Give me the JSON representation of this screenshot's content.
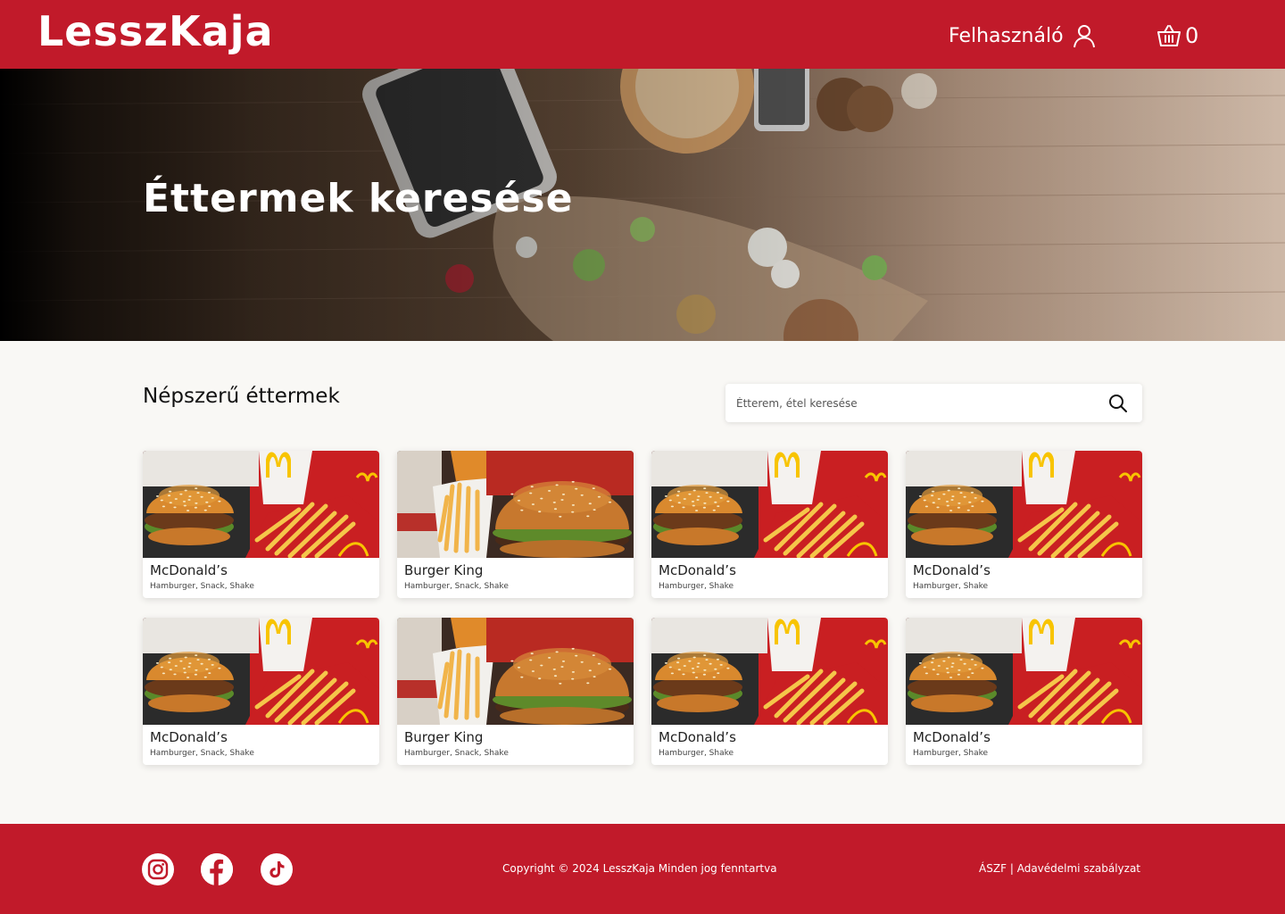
{
  "colors": {
    "brand": "#c11a2a",
    "page_bg": "#f9f8f5",
    "card_bg": "#ffffff"
  },
  "header": {
    "logo": "LesszKaja",
    "user_label": "Felhasználó",
    "user_icon": "user-icon",
    "cart_icon": "basket-icon",
    "cart_count": "0"
  },
  "hero": {
    "title": "Éttermek keresése"
  },
  "main": {
    "section_title": "Népszerű éttermek",
    "search": {
      "placeholder": "Étterem, étel keresése",
      "icon": "search-icon"
    },
    "restaurants": [
      {
        "name": "McDonald’s",
        "tags": "Hamburger, Snack, Shake",
        "image": "mcdonalds-meal"
      },
      {
        "name": "Burger King",
        "tags": "Hamburger, Snack, Shake",
        "image": "burger-king-meal"
      },
      {
        "name": "McDonald’s",
        "tags": "Hamburger, Shake",
        "image": "mcdonalds-meal"
      },
      {
        "name": "McDonald’s",
        "tags": "Hamburger, Shake",
        "image": "mcdonalds-meal"
      },
      {
        "name": "McDonald’s",
        "tags": "Hamburger, Snack, Shake",
        "image": "mcdonalds-meal"
      },
      {
        "name": "Burger King",
        "tags": "Hamburger, Snack, Shake",
        "image": "burger-king-meal"
      },
      {
        "name": "McDonald’s",
        "tags": "Hamburger, Shake",
        "image": "mcdonalds-meal"
      },
      {
        "name": "McDonald’s",
        "tags": "Hamburger, Shake",
        "image": "mcdonalds-meal"
      }
    ]
  },
  "footer": {
    "social": [
      "instagram-icon",
      "facebook-icon",
      "tiktok-icon"
    ],
    "copyright": "Copyright © 2024 LesszKaja Minden jog fenntartva",
    "terms": "ÁSZF",
    "separator": "|",
    "privacy": "Adavédelmi szabályzat"
  }
}
